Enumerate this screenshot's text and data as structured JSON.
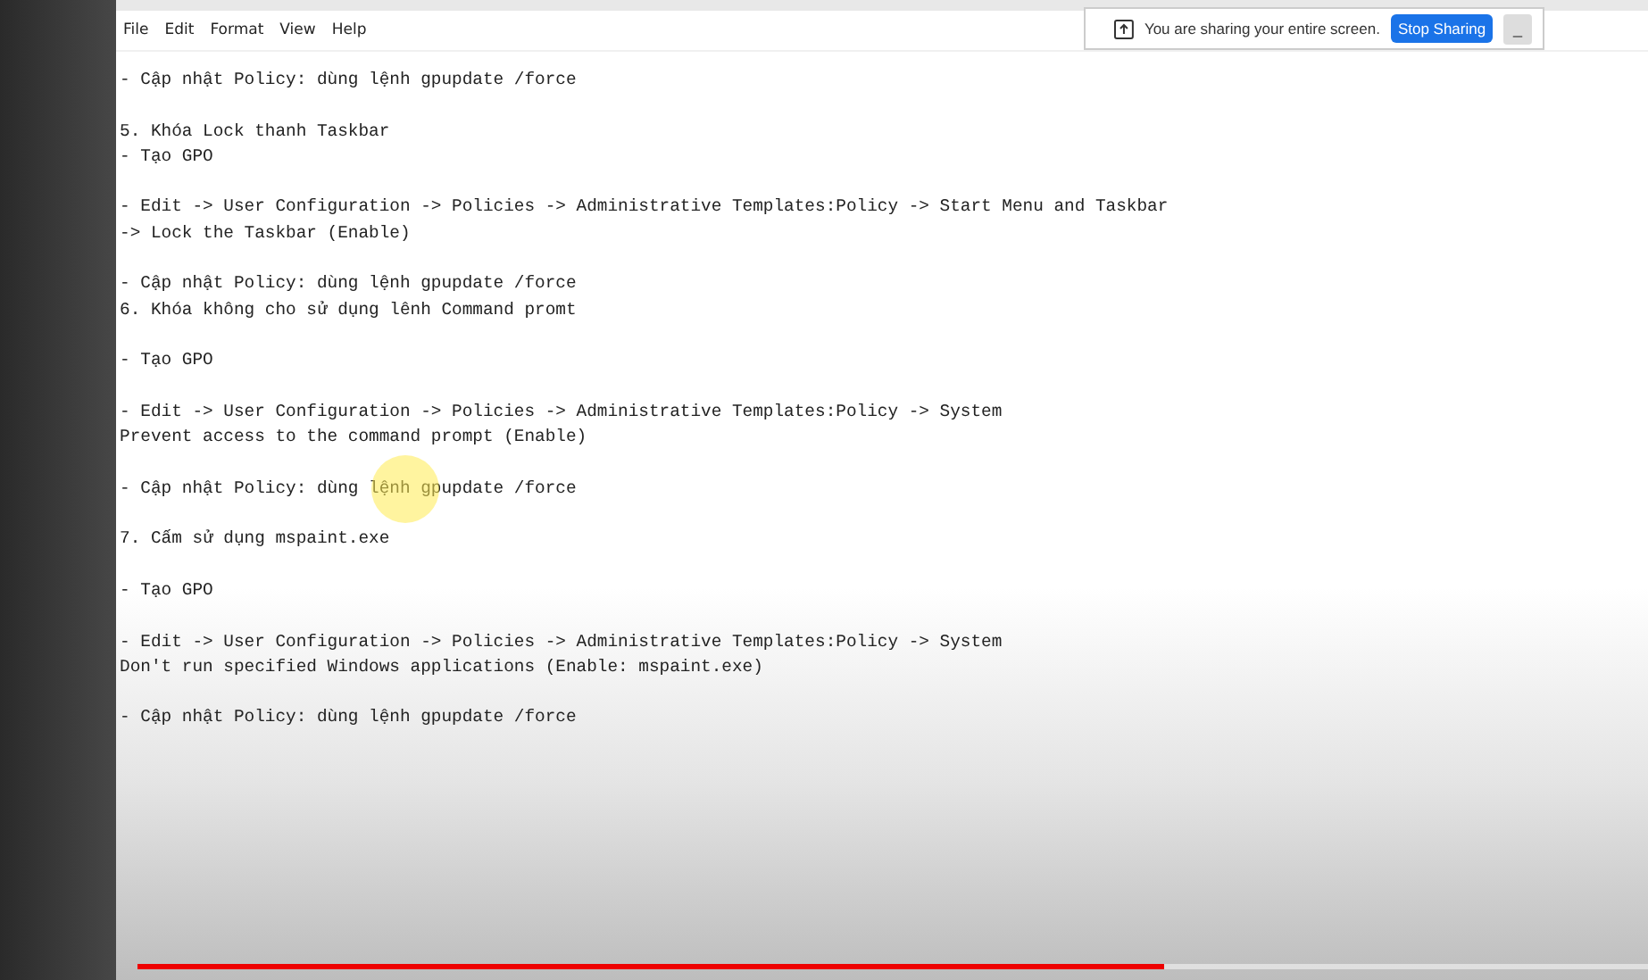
{
  "menu": [
    "File",
    "Edit",
    "Format",
    "View",
    "Help"
  ],
  "share_bar": {
    "message": "You are sharing your entire screen.",
    "button": "Stop Sharing",
    "minimize": "_"
  },
  "blocks": [
    [
      "- Cập nhật Policy: dùng lệnh gpupdate /force"
    ],
    [
      "5. Khóa Lock thanh Taskbar",
      "- Tạo GPO"
    ],
    [
      "- Edit -> User Configuration -> Policies -> Administrative Templates:Policy -> Start Menu and Taskbar",
      "-> Lock the Taskbar (Enable)"
    ],
    [
      "- Cập nhật Policy: dùng lệnh gpupdate /force",
      "6. Khóa không cho sử dụng lênh Command promt"
    ],
    [
      "- Tạo GPO"
    ],
    [
      "- Edit -> User Configuration -> Policies -> Administrative Templates:Policy -> System",
      "Prevent access to the command prompt (Enable)"
    ],
    [
      "- Cập nhật Policy: dùng lệnh gpupdate /force"
    ],
    [
      "7. Cấm sử dụng mspaint.exe"
    ],
    [
      "- Tạo GPO"
    ],
    [
      "- Edit -> User Configuration -> Policies -> Administrative Templates:Policy -> System",
      "Don't run specified Windows applications (Enable: mspaint.exe)"
    ],
    [
      "- Cập nhật Policy: dùng lệnh gpupdate /force"
    ]
  ],
  "video_progress": {
    "level": 0.68
  }
}
